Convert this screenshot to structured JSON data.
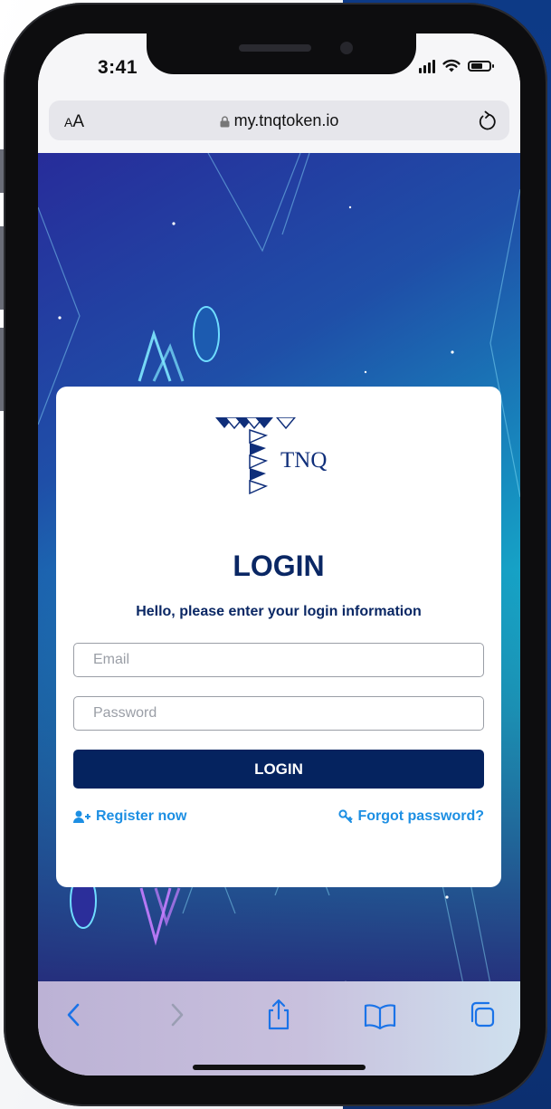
{
  "status_bar": {
    "time": "3:41"
  },
  "browser": {
    "text_size_label_small": "A",
    "text_size_label_large": "A",
    "url": "my.tnqtoken.io"
  },
  "login": {
    "logo_text": "TNQ",
    "title": "LOGIN",
    "subtitle": "Hello, please enter your login information",
    "email_placeholder": "Email",
    "password_placeholder": "Password",
    "submit_label": "LOGIN",
    "register_label": "Register now",
    "forgot_label": "Forgot password?"
  },
  "colors": {
    "brand_navy": "#05235f",
    "link_blue": "#1d8fe3",
    "background_teal": "#18d8cf",
    "background_indigo": "#272c9a"
  },
  "toolbar_icons": [
    "back-icon",
    "forward-icon",
    "share-icon",
    "bookmarks-icon",
    "tabs-icon"
  ]
}
